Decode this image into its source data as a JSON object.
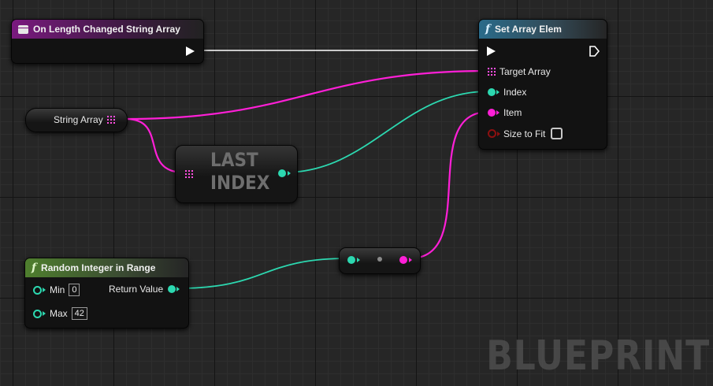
{
  "event_node": {
    "title": "On Length Changed String Array"
  },
  "set_array_node": {
    "title": "Set Array Elem",
    "pins": {
      "target_array": "Target Array",
      "index": "Index",
      "item": "Item",
      "size_to_fit": "Size to Fit"
    },
    "size_to_fit_checked": false
  },
  "string_array_node": {
    "label": "String Array"
  },
  "last_index_node": {
    "label_line1": "LAST",
    "label_line2": "INDEX"
  },
  "random_node": {
    "title": "Random Integer in Range",
    "min_label": "Min",
    "min_value": "0",
    "max_label": "Max",
    "max_value": "42",
    "return_label": "Return Value"
  },
  "watermark": "BLUEPRINT",
  "colors": {
    "exec": "#ffffff",
    "integer": "#2cd8b0",
    "string": "#ff1fd7",
    "bool": "#8c1010",
    "event_header": "#7a1a7f",
    "function_header": "#2a6b8a",
    "pure_header": "#4f7f2e"
  }
}
